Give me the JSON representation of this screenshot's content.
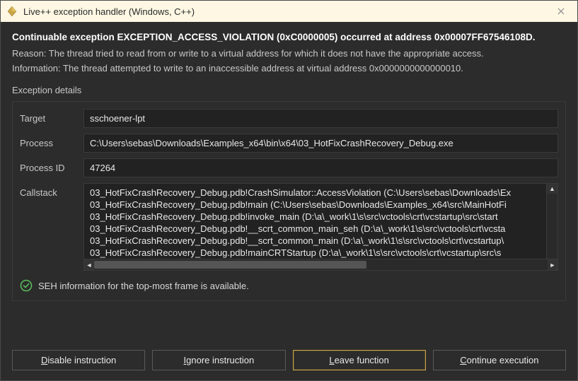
{
  "titlebar": {
    "title": "Live++ exception handler (Windows, C++)"
  },
  "headline": "Continuable exception EXCEPTION_ACCESS_VIOLATION (0xC0000005) occurred at address 0x00007FF67546108D.",
  "reason": "Reason: The thread tried to read from or write to a virtual address for which it does not have the appropriate access.",
  "information": "Information: The thread attempted to write to an inaccessible address at virtual address 0x0000000000000010.",
  "section_label": "Exception details",
  "fields": {
    "target_label": "Target",
    "target_value": "sschoener-lpt",
    "process_label": "Process",
    "process_value": "C:\\Users\\sebas\\Downloads\\Examples_x64\\bin\\x64\\03_HotFixCrashRecovery_Debug.exe",
    "pid_label": "Process ID",
    "pid_value": "47264",
    "callstack_label": "Callstack"
  },
  "callstack": [
    "03_HotFixCrashRecovery_Debug.pdb!CrashSimulator::AccessViolation (C:\\Users\\sebas\\Downloads\\Ex",
    "03_HotFixCrashRecovery_Debug.pdb!main (C:\\Users\\sebas\\Downloads\\Examples_x64\\src\\MainHotFi",
    "03_HotFixCrashRecovery_Debug.pdb!invoke_main (D:\\a\\_work\\1\\s\\src\\vctools\\crt\\vcstartup\\src\\start",
    "03_HotFixCrashRecovery_Debug.pdb!__scrt_common_main_seh (D:\\a\\_work\\1\\s\\src\\vctools\\crt\\vcsta",
    "03_HotFixCrashRecovery_Debug.pdb!__scrt_common_main (D:\\a\\_work\\1\\s\\src\\vctools\\crt\\vcstartup\\",
    "03_HotFixCrashRecovery_Debug.pdb!mainCRTStartup (D:\\a\\_work\\1\\s\\src\\vctools\\crt\\vcstartup\\src\\s"
  ],
  "seh_message": "SEH information for the top-most frame is available.",
  "buttons": {
    "disable": {
      "mn": "D",
      "rest": "isable instruction"
    },
    "ignore": {
      "mn": "I",
      "rest": "gnore instruction"
    },
    "leave": {
      "mn": "L",
      "rest": "eave function"
    },
    "cont": {
      "mn": "C",
      "rest": "ontinue execution"
    }
  }
}
